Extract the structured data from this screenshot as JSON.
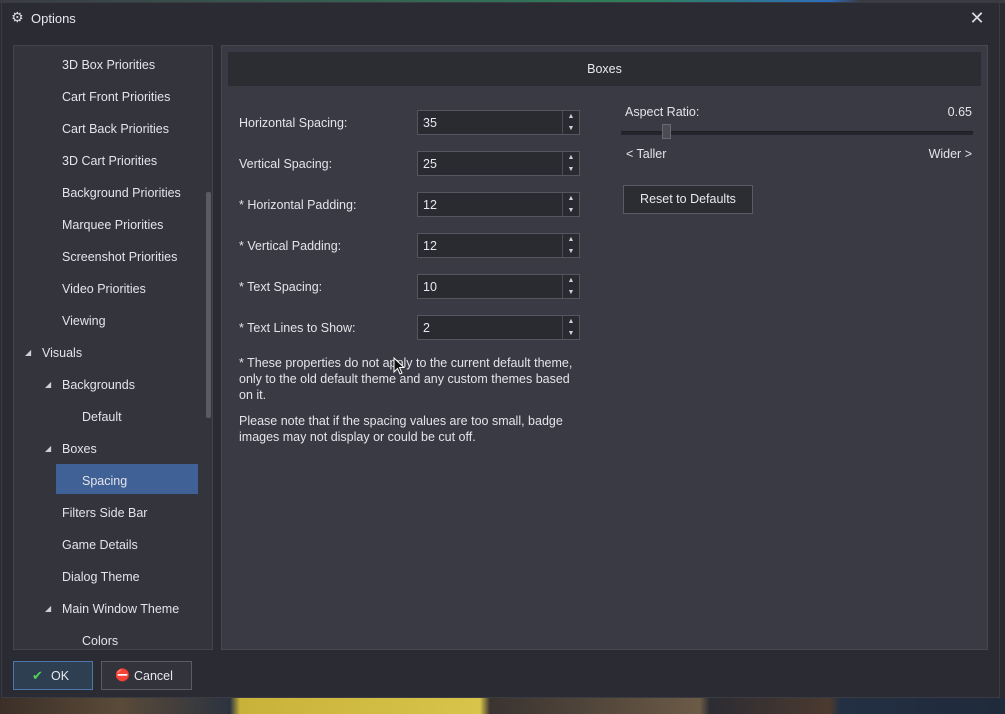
{
  "window": {
    "title": "Options",
    "title_icon": "gear-icon",
    "close_icon": "close-icon"
  },
  "tree": {
    "items": [
      {
        "label": "3D Box Priorities",
        "level": 1
      },
      {
        "label": "Cart Front Priorities",
        "level": 1
      },
      {
        "label": "Cart Back Priorities",
        "level": 1
      },
      {
        "label": "3D Cart Priorities",
        "level": 1
      },
      {
        "label": "Background Priorities",
        "level": 1
      },
      {
        "label": "Marquee Priorities",
        "level": 1
      },
      {
        "label": "Screenshot Priorities",
        "level": 1
      },
      {
        "label": "Video Priorities",
        "level": 1
      },
      {
        "label": "Viewing",
        "level": 1
      },
      {
        "label": "Visuals",
        "level": 0,
        "expanded": true
      },
      {
        "label": "Backgrounds",
        "level": 1,
        "expanded": true
      },
      {
        "label": "Default",
        "level": 2
      },
      {
        "label": "Boxes",
        "level": 1,
        "expanded": true
      },
      {
        "label": "Spacing",
        "level": 2,
        "selected": true
      },
      {
        "label": "Filters Side Bar",
        "level": 1
      },
      {
        "label": "Game Details",
        "level": 1
      },
      {
        "label": "Dialog Theme",
        "level": 1
      },
      {
        "label": "Main Window Theme",
        "level": 1,
        "expanded": true
      },
      {
        "label": "Colors",
        "level": 2
      }
    ],
    "selected_color": "#3f6196"
  },
  "section": {
    "title": "Boxes"
  },
  "fields": [
    {
      "label": "Horizontal Spacing:",
      "value": "35"
    },
    {
      "label": "Vertical Spacing:",
      "value": "25"
    },
    {
      "label": "* Horizontal Padding:",
      "value": "12"
    },
    {
      "label": "* Vertical Padding:",
      "value": "12"
    },
    {
      "label": "* Text Spacing:",
      "value": "10"
    },
    {
      "label": "* Text Lines to Show:",
      "value": "2"
    }
  ],
  "notes": {
    "asterisk": "* These properties do not apply to the current default theme, only to the old default theme and any custom themes based on it.",
    "spacing": "Please note that if the spacing values are too small, badge images may not display or could be cut off."
  },
  "aspect": {
    "label": "Aspect Ratio:",
    "value": "0.65",
    "slider_fraction": 0.12,
    "taller_label": "< Taller",
    "wider_label": "Wider >",
    "reset_label": "Reset to Defaults"
  },
  "footer": {
    "ok_label": "OK",
    "ok_icon": "check-icon",
    "cancel_label": "Cancel",
    "cancel_icon": "cancel-icon",
    "ok_icon_color": "#55d05a",
    "cancel_icon_color": "#e0433b"
  }
}
